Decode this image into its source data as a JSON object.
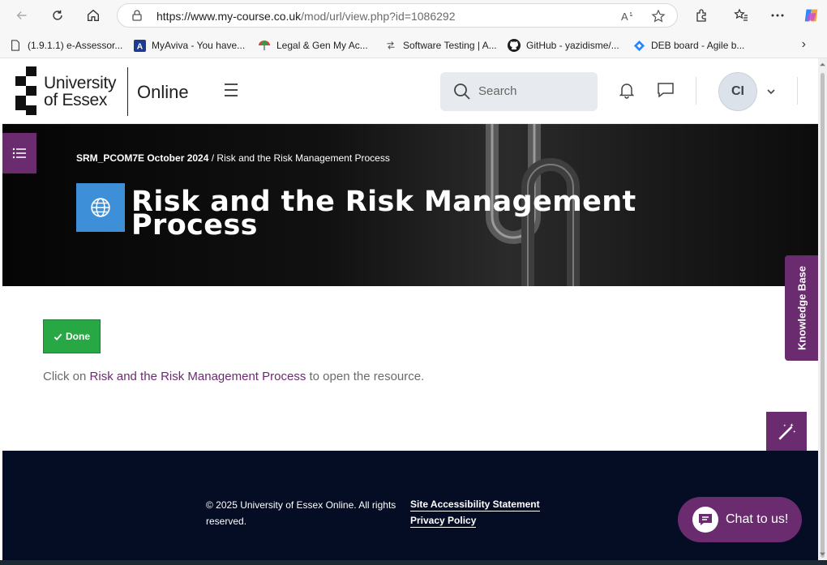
{
  "browser": {
    "url_host": "https://www.my-course.co.uk",
    "url_path": "/mod/url/view.php?id=1086292",
    "bookmarks": [
      {
        "label": "(1.9.1.1) e-Assessor...",
        "icon": "document-icon"
      },
      {
        "label": "MyAviva - You have...",
        "icon": "aviva-icon"
      },
      {
        "label": "Legal & Gen My Ac...",
        "icon": "umbrella-icon"
      },
      {
        "label": "Software Testing | A...",
        "icon": "arrows-icon"
      },
      {
        "label": "GitHub - yazidisme/...",
        "icon": "github-icon"
      },
      {
        "label": "DEB board - Agile b...",
        "icon": "jira-icon"
      }
    ]
  },
  "header": {
    "logo_line1": "University",
    "logo_line2": "of Essex",
    "logo_online": "Online",
    "search_placeholder": "Search",
    "avatar_initials": "CI"
  },
  "hero": {
    "breadcrumb_course": "SRM_PCOM7E October 2024",
    "breadcrumb_sep": " / ",
    "breadcrumb_page": "Risk and the Risk Management Process",
    "title": "Risk and the Risk Management Process"
  },
  "content": {
    "done_label": "Done",
    "desc_prefix": "Click on ",
    "desc_link": "Risk and the Risk Management Process",
    "desc_suffix": " to open the resource.",
    "knowledge_base_label": "Knowledge Base"
  },
  "footer": {
    "copyright": "© 2025 University of Essex Online. All rights reserved.",
    "accessibility_link": "Site Accessibility Statement",
    "privacy_link": "Privacy Policy",
    "chat_label": "Chat to us!"
  },
  "colors": {
    "brand_purple": "#6a2c6f",
    "done_green": "#28a745",
    "footer_navy": "#040d24",
    "page_icon_blue": "#3d8fd8"
  }
}
